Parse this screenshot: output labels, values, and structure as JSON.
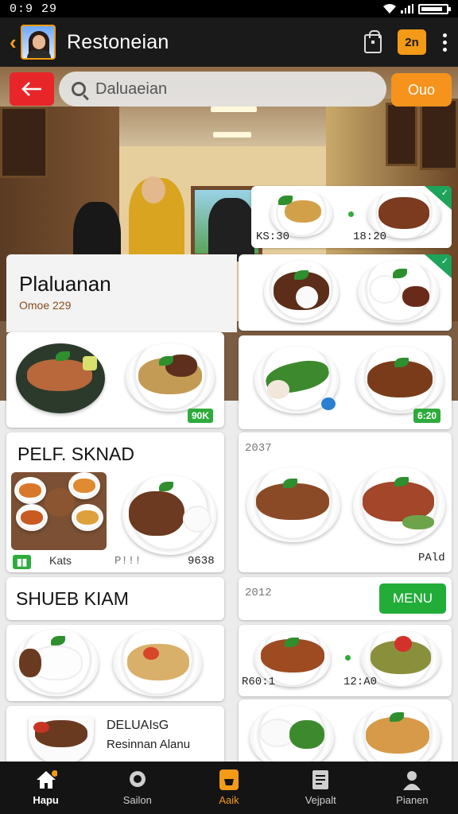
{
  "status_bar": {
    "time": "0:9 29"
  },
  "app_bar": {
    "title": "Restoneian",
    "cart_badge": "2n"
  },
  "search": {
    "placeholder": "Daluaeian"
  },
  "top_action": {
    "label": "Ouo"
  },
  "featured": {
    "title": "Plaluanan",
    "subtitle": "Omoe 229",
    "top_right_prices": [
      "KS:30",
      "18:20"
    ]
  },
  "cards": {
    "pasta_tag": "90K",
    "vegetable_tag": "6:20",
    "combo_title": "PELF. SKNAD",
    "combo_tag": "Kats",
    "combo_price_1": "P!!!",
    "combo_price_2": "9638",
    "grill_code": "2037",
    "grill_price": "PAld",
    "section_title": "SHUEB KIAM",
    "menu_code": "2012",
    "menu_button": "MENU",
    "meat_prices": [
      "R60:1",
      "12:A0"
    ],
    "promo_title": "DELUAIsG",
    "promo_subtitle": "Resinnan Alanu"
  },
  "bottom_nav": [
    {
      "label": "Hapu",
      "icon": "home-icon"
    },
    {
      "label": "Sailon",
      "icon": "chef-icon"
    },
    {
      "label": "Aaik",
      "icon": "basket-icon"
    },
    {
      "label": "Vejpalt",
      "icon": "receipt-icon"
    },
    {
      "label": "Pianen",
      "icon": "profile-icon"
    }
  ],
  "colors": {
    "accent_orange": "#f39a17",
    "accent_red": "#e8262a",
    "accent_green": "#22ac38",
    "appbar_bg": "#1a1a1a"
  }
}
